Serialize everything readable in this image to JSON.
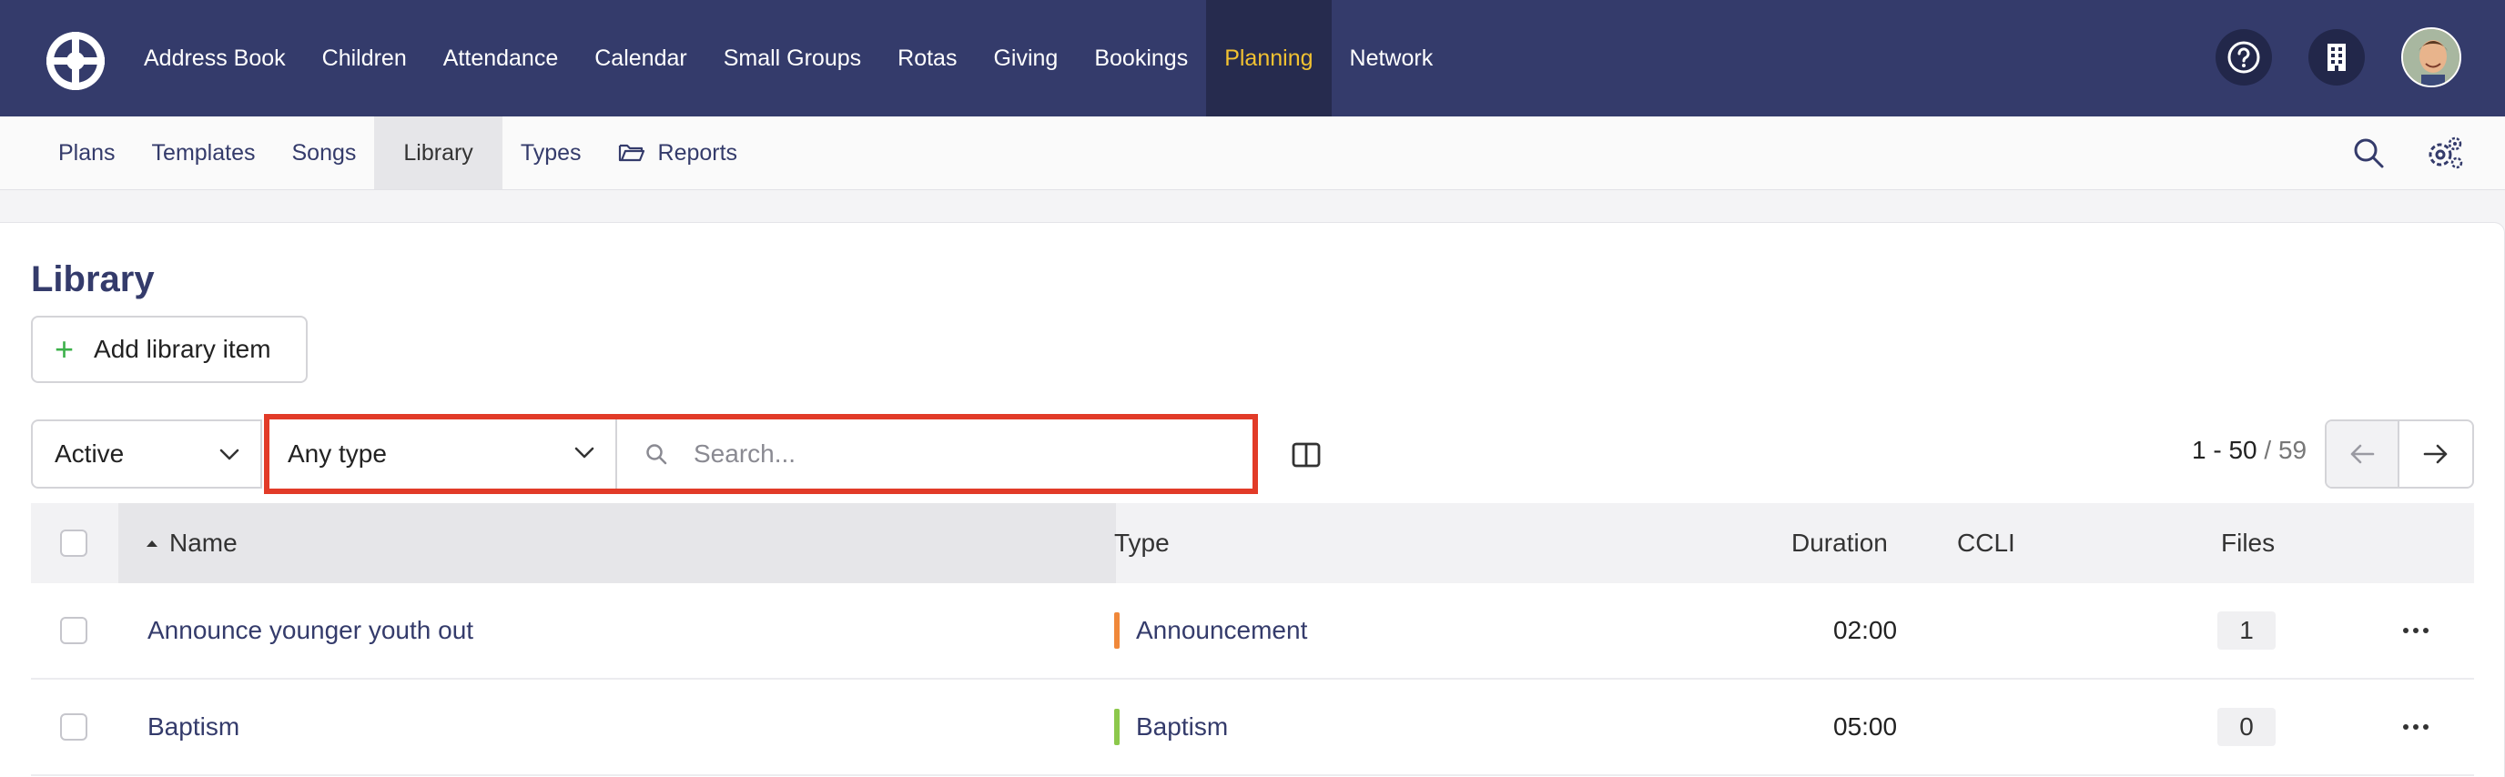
{
  "topnav": {
    "items": [
      {
        "label": "Address Book"
      },
      {
        "label": "Children"
      },
      {
        "label": "Attendance"
      },
      {
        "label": "Calendar"
      },
      {
        "label": "Small Groups"
      },
      {
        "label": "Rotas"
      },
      {
        "label": "Giving"
      },
      {
        "label": "Bookings"
      },
      {
        "label": "Planning",
        "active": true
      },
      {
        "label": "Network"
      }
    ],
    "colors": {
      "bg": "#343b6b",
      "active_bg": "#262b4e",
      "active_text": "#f2c231"
    }
  },
  "subnav": {
    "items": [
      {
        "label": "Plans"
      },
      {
        "label": "Templates"
      },
      {
        "label": "Songs"
      },
      {
        "label": "Library",
        "active": true
      },
      {
        "label": "Types"
      },
      {
        "label": "Reports",
        "icon": "folder-open-icon"
      }
    ]
  },
  "page": {
    "title": "Library",
    "add_button": "Add library item"
  },
  "filters": {
    "status": "Active",
    "type": "Any type",
    "search_placeholder": "Search..."
  },
  "pagination": {
    "range": "1 - 50",
    "total": "/ 59"
  },
  "table": {
    "headers": {
      "name": "Name",
      "type": "Type",
      "duration": "Duration",
      "ccli": "CCLI",
      "files": "Files"
    },
    "rows": [
      {
        "name": "Announce younger youth out",
        "type": "Announcement",
        "type_color": "#f0883a",
        "duration": "02:00",
        "ccli": "",
        "files": "1"
      },
      {
        "name": "Baptism",
        "type": "Baptism",
        "type_color": "#8cc84b",
        "duration": "05:00",
        "ccli": "",
        "files": "0"
      }
    ]
  }
}
